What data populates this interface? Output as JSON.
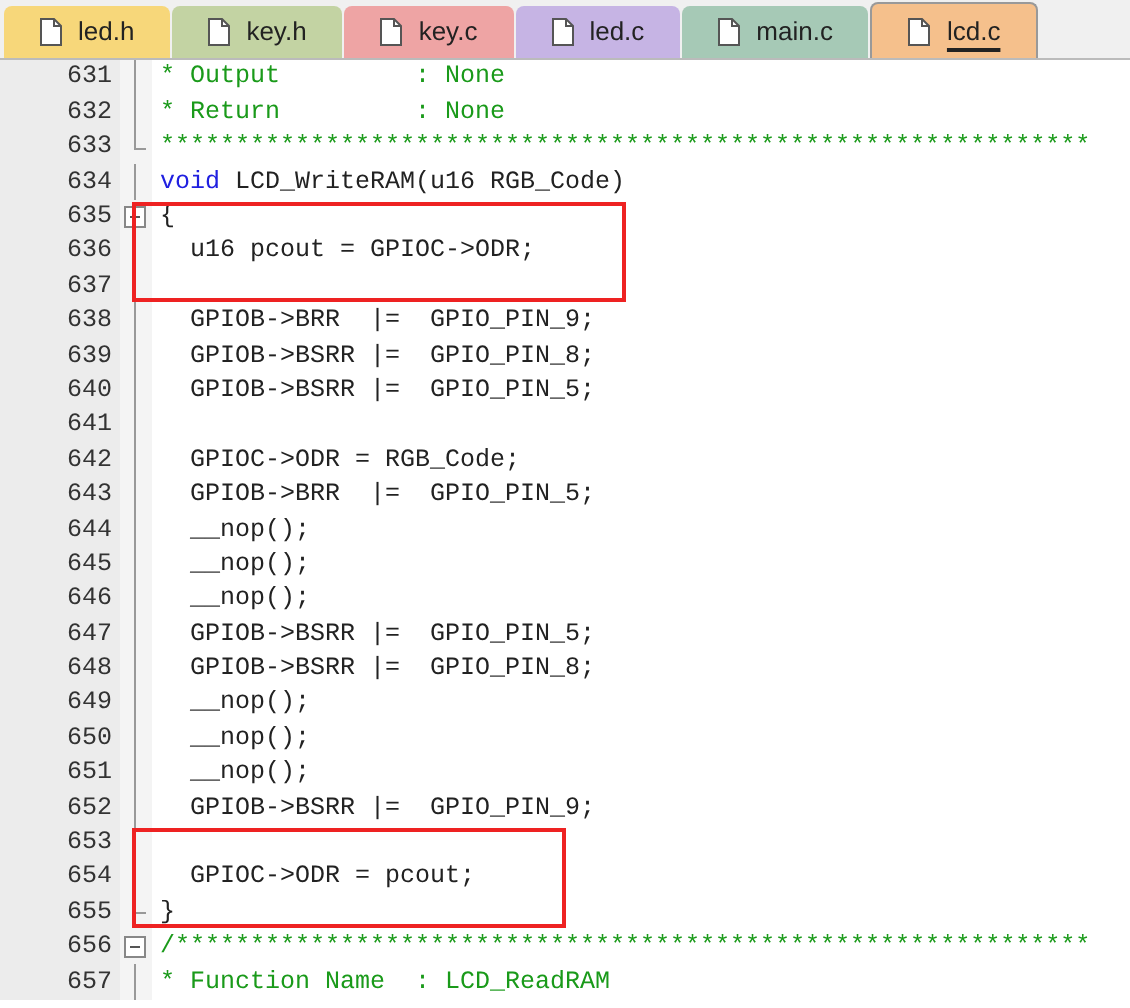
{
  "tabs": [
    {
      "label": "led.h",
      "color": "#f7d77a",
      "selected": false
    },
    {
      "label": "key.h",
      "color": "#c3d3a3",
      "selected": false
    },
    {
      "label": "key.c",
      "color": "#eea4a4",
      "selected": false
    },
    {
      "label": "led.c",
      "color": "#c6b4e4",
      "selected": false
    },
    {
      "label": "main.c",
      "color": "#a6c9b6",
      "selected": false
    },
    {
      "label": "lcd.c",
      "color": "#f5c08c",
      "selected": true
    }
  ],
  "lines": [
    {
      "number": "631",
      "fold_start": false,
      "fold_end": false,
      "highlighted": false,
      "tokens": [
        {
          "kind": "comment",
          "text": "* Output         : None"
        }
      ]
    },
    {
      "number": "632",
      "fold_start": false,
      "fold_end": false,
      "highlighted": false,
      "tokens": [
        {
          "kind": "comment",
          "text": "* Return         : None"
        }
      ]
    },
    {
      "number": "633",
      "fold_start": false,
      "fold_end": true,
      "highlighted": false,
      "tokens": [
        {
          "kind": "comment",
          "text": "**************************************************************"
        }
      ]
    },
    {
      "number": "634",
      "fold_start": false,
      "fold_end": false,
      "highlighted": false,
      "tokens": [
        {
          "kind": "keyword",
          "text": "void"
        },
        {
          "kind": "plain",
          "text": " LCD_WriteRAM(u16 RGB_Code)"
        }
      ]
    },
    {
      "number": "635",
      "fold_start": true,
      "fold_end": false,
      "highlighted": true,
      "tokens": [
        {
          "kind": "plain",
          "text": "{"
        }
      ]
    },
    {
      "number": "636",
      "fold_start": false,
      "fold_end": false,
      "highlighted": true,
      "tokens": [
        {
          "kind": "plain",
          "text": "  u16 pcout = GPIOC->ODR;"
        }
      ]
    },
    {
      "number": "637",
      "fold_start": false,
      "fold_end": false,
      "highlighted": true
    },
    {
      "number": "638",
      "fold_start": false,
      "fold_end": false,
      "highlighted": false,
      "tokens": [
        {
          "kind": "plain",
          "text": "  GPIOB->BRR  |=  GPIO_PIN_9;"
        }
      ]
    },
    {
      "number": "639",
      "fold_start": false,
      "fold_end": false,
      "highlighted": false,
      "tokens": [
        {
          "kind": "plain",
          "text": "  GPIOB->BSRR |=  GPIO_PIN_8;"
        }
      ]
    },
    {
      "number": "640",
      "fold_start": false,
      "fold_end": false,
      "highlighted": false,
      "tokens": [
        {
          "kind": "plain",
          "text": "  GPIOB->BSRR |=  GPIO_PIN_5;"
        }
      ]
    },
    {
      "number": "641",
      "fold_start": false,
      "fold_end": false,
      "highlighted": false
    },
    {
      "number": "642",
      "fold_start": false,
      "fold_end": false,
      "highlighted": false,
      "tokens": [
        {
          "kind": "plain",
          "text": "  GPIOC->ODR = RGB_Code;"
        }
      ]
    },
    {
      "number": "643",
      "fold_start": false,
      "fold_end": false,
      "highlighted": false,
      "tokens": [
        {
          "kind": "plain",
          "text": "  GPIOB->BRR  |=  GPIO_PIN_5;"
        }
      ]
    },
    {
      "number": "644",
      "fold_start": false,
      "fold_end": false,
      "highlighted": false,
      "tokens": [
        {
          "kind": "plain",
          "text": "  __nop();"
        }
      ]
    },
    {
      "number": "645",
      "fold_start": false,
      "fold_end": false,
      "highlighted": false,
      "tokens": [
        {
          "kind": "plain",
          "text": "  __nop();"
        }
      ]
    },
    {
      "number": "646",
      "fold_start": false,
      "fold_end": false,
      "highlighted": false,
      "tokens": [
        {
          "kind": "plain",
          "text": "  __nop();"
        }
      ]
    },
    {
      "number": "647",
      "fold_start": false,
      "fold_end": false,
      "highlighted": false,
      "tokens": [
        {
          "kind": "plain",
          "text": "  GPIOB->BSRR |=  GPIO_PIN_5;"
        }
      ]
    },
    {
      "number": "648",
      "fold_start": false,
      "fold_end": false,
      "highlighted": false,
      "tokens": [
        {
          "kind": "plain",
          "text": "  GPIOB->BSRR |=  GPIO_PIN_8;"
        }
      ]
    },
    {
      "number": "649",
      "fold_start": false,
      "fold_end": false,
      "highlighted": false,
      "tokens": [
        {
          "kind": "plain",
          "text": "  __nop();"
        }
      ]
    },
    {
      "number": "650",
      "fold_start": false,
      "fold_end": false,
      "highlighted": false,
      "tokens": [
        {
          "kind": "plain",
          "text": "  __nop();"
        }
      ]
    },
    {
      "number": "651",
      "fold_start": false,
      "fold_end": false,
      "highlighted": false,
      "tokens": [
        {
          "kind": "plain",
          "text": "  __nop();"
        }
      ]
    },
    {
      "number": "652",
      "fold_start": false,
      "fold_end": false,
      "highlighted": false,
      "tokens": [
        {
          "kind": "plain",
          "text": "  GPIOB->BSRR |=  GPIO_PIN_9;"
        }
      ]
    },
    {
      "number": "653",
      "fold_start": false,
      "fold_end": false,
      "highlighted": true
    },
    {
      "number": "654",
      "fold_start": false,
      "fold_end": false,
      "highlighted": true,
      "tokens": [
        {
          "kind": "plain",
          "text": "  GPIOC->ODR = pcout;"
        }
      ]
    },
    {
      "number": "655",
      "fold_start": false,
      "fold_end": true,
      "highlighted": true,
      "tokens": [
        {
          "kind": "plain",
          "text": "}"
        }
      ]
    },
    {
      "number": "656",
      "fold_start": true,
      "fold_end": false,
      "highlighted": false,
      "tokens": [
        {
          "kind": "comment",
          "text": "/*************************************************************"
        }
      ]
    },
    {
      "number": "657",
      "fold_start": false,
      "fold_end": false,
      "highlighted": false,
      "tokens": [
        {
          "kind": "comment",
          "text": "* Function Name  : LCD_ReadRAM"
        }
      ]
    }
  ]
}
